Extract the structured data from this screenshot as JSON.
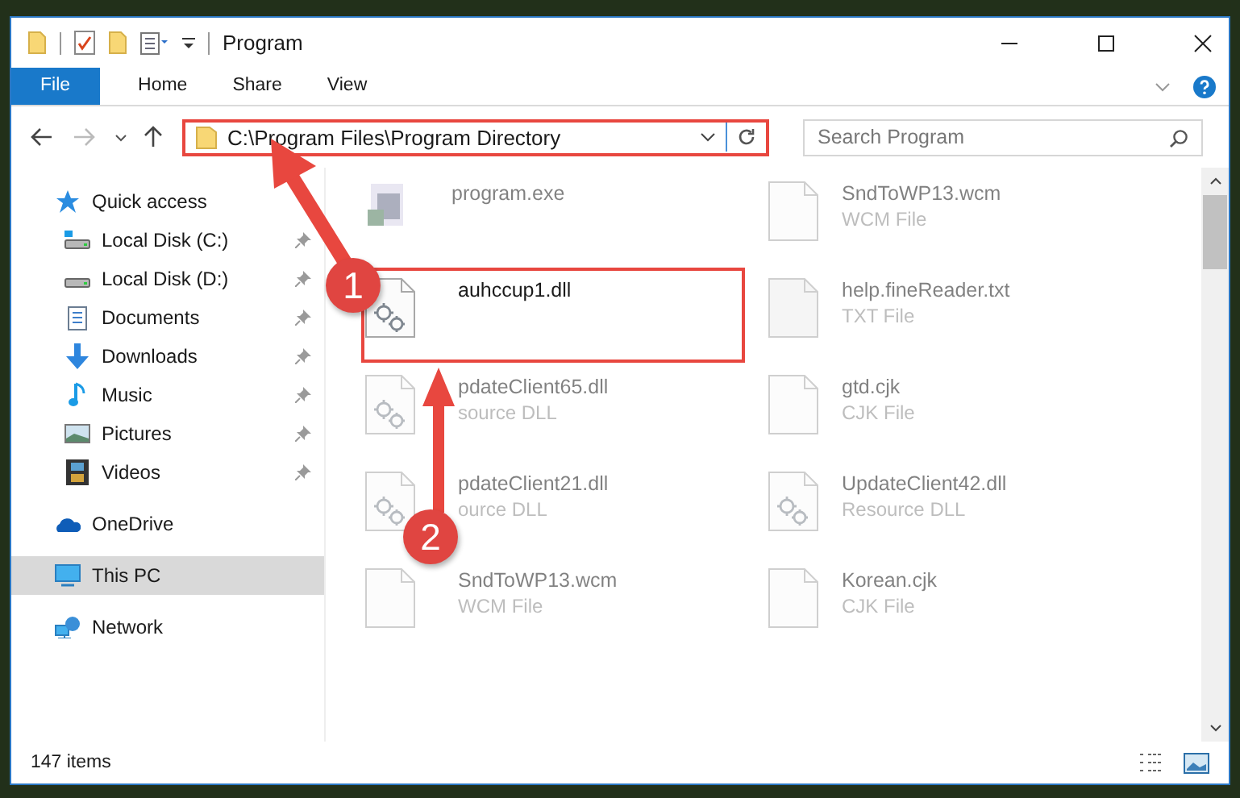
{
  "title_bar": {
    "title": "Program"
  },
  "ribbon": {
    "tabs": [
      {
        "label": "File",
        "kind": "file"
      },
      {
        "label": "Home",
        "kind": "tab"
      },
      {
        "label": "Share",
        "kind": "tab"
      },
      {
        "label": "View",
        "kind": "tab"
      }
    ]
  },
  "address_bar": {
    "path": "C:\\Program Files\\Program Directory",
    "highlighted": true
  },
  "search": {
    "placeholder": "Search Program"
  },
  "navigation": [
    {
      "label": "Quick access",
      "kind": "star",
      "selected": false,
      "children": [
        {
          "label": "Local Disk (C:)",
          "kind": "sysdrive",
          "pinned": true,
          "selected": false
        },
        {
          "label": "Local Disk (D:)",
          "kind": "drive",
          "pinned": true,
          "selected": false
        },
        {
          "label": "Documents",
          "kind": "document",
          "pinned": true,
          "selected": false
        },
        {
          "label": "Downloads",
          "kind": "download",
          "pinned": true,
          "selected": false
        },
        {
          "label": "Music",
          "kind": "music",
          "pinned": true,
          "selected": false
        },
        {
          "label": "Pictures",
          "kind": "pictures",
          "pinned": true,
          "selected": false
        },
        {
          "label": "Videos",
          "kind": "videos",
          "pinned": true,
          "selected": false
        }
      ]
    },
    {
      "label": "OneDrive",
      "kind": "cloud",
      "selected": false
    },
    {
      "label": "This PC",
      "kind": "computer",
      "selected": true
    },
    {
      "label": "Network",
      "kind": "network",
      "selected": false
    }
  ],
  "files": [
    {
      "name": "program.exe",
      "kind": "exe",
      "blurred": true,
      "highlighted": false
    },
    {
      "name": "SndToWP13.wcm",
      "type": "WCM File",
      "kind": "blank",
      "blurred": true,
      "highlighted": false
    },
    {
      "name": "auhccup1.dll",
      "kind": "dll",
      "blurred": false,
      "highlighted": true
    },
    {
      "name": "help.fineReader.txt",
      "type": "TXT File",
      "kind": "text",
      "blurred": true,
      "highlighted": false
    },
    {
      "name": "pdateClient65.dll",
      "type": "source DLL",
      "kind": "dll",
      "blurred": true,
      "highlighted": false
    },
    {
      "name": "gtd.cjk",
      "type": "CJK File",
      "kind": "blank",
      "blurred": true,
      "highlighted": false
    },
    {
      "name": "pdateClient21.dll",
      "type": "ource DLL",
      "kind": "dll",
      "blurred": true,
      "highlighted": false
    },
    {
      "name": "UpdateClient42.dll",
      "type": "Resource DLL",
      "kind": "dll",
      "blurred": true,
      "highlighted": false
    },
    {
      "name": "SndToWP13.wcm",
      "type": "WCM File",
      "kind": "blank",
      "blurred": true,
      "highlighted": false
    },
    {
      "name": "Korean.cjk",
      "type": "CJK File",
      "kind": "blank",
      "blurred": true,
      "highlighted": false
    }
  ],
  "callouts": [
    {
      "label": "1"
    },
    {
      "label": "2"
    }
  ],
  "status_bar": {
    "count": "147 items"
  }
}
